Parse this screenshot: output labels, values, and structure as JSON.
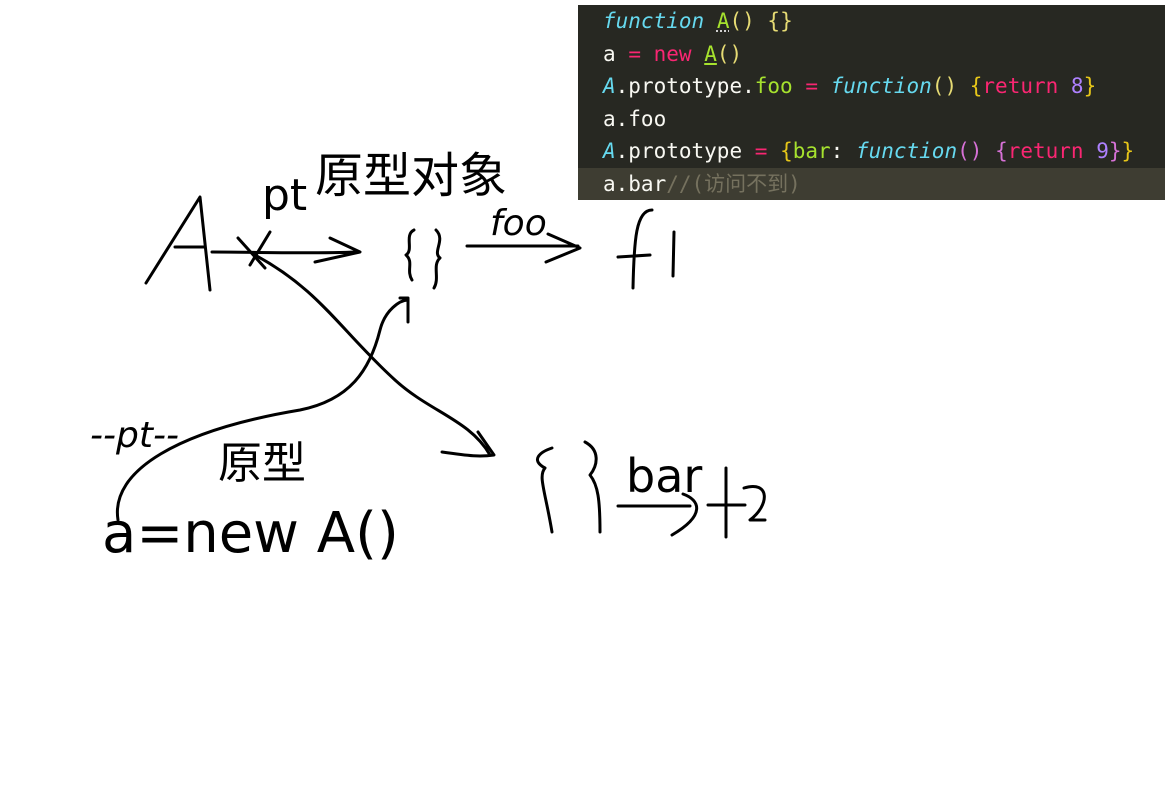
{
  "diagram": {
    "labels": {
      "a_node": "A",
      "pt_top": "pt",
      "proto_obj_label": "原型对象",
      "empty_obj_1": "{}",
      "foo_edge": "foo",
      "f1_node": "f1",
      "pt_dashed": "--pt--",
      "proto_label_2": "原型",
      "instance_expr": "a=new A()",
      "empty_obj_2": "{}",
      "bar_edge": "bar",
      "f2_node": "f2"
    }
  },
  "code": {
    "lines": [
      {
        "tokens": [
          {
            "t": "function",
            "c": "kw"
          },
          {
            "t": " ",
            "c": "id"
          },
          {
            "t": "A",
            "c": "nm dots"
          },
          {
            "t": "()",
            "c": "pn"
          },
          {
            "t": " ",
            "c": "id"
          },
          {
            "t": "{}",
            "c": "pn"
          }
        ]
      },
      {
        "tokens": [
          {
            "t": "a",
            "c": "id"
          },
          {
            "t": " ",
            "c": "id"
          },
          {
            "t": "=",
            "c": "op"
          },
          {
            "t": " ",
            "c": "id"
          },
          {
            "t": "new",
            "c": "op"
          },
          {
            "t": " ",
            "c": "id"
          },
          {
            "t": "A",
            "c": "nm ul"
          },
          {
            "t": "()",
            "c": "pn"
          }
        ]
      },
      {
        "tokens": [
          {
            "t": "A",
            "c": "cls"
          },
          {
            "t": ".prototype.",
            "c": "id"
          },
          {
            "t": "foo",
            "c": "nm"
          },
          {
            "t": " ",
            "c": "id"
          },
          {
            "t": "=",
            "c": "op"
          },
          {
            "t": " ",
            "c": "id"
          },
          {
            "t": "function",
            "c": "kw"
          },
          {
            "t": "()",
            "c": "pn"
          },
          {
            "t": " ",
            "c": "id"
          },
          {
            "t": "{",
            "c": "brace1"
          },
          {
            "t": "return",
            "c": "op"
          },
          {
            "t": " ",
            "c": "id"
          },
          {
            "t": "8",
            "c": "num"
          },
          {
            "t": "}",
            "c": "brace1"
          }
        ]
      },
      {
        "tokens": [
          {
            "t": "a.foo",
            "c": "id"
          }
        ]
      },
      {
        "tokens": [
          {
            "t": "A",
            "c": "cls"
          },
          {
            "t": ".prototype",
            "c": "id"
          },
          {
            "t": " ",
            "c": "id"
          },
          {
            "t": "=",
            "c": "op"
          },
          {
            "t": " ",
            "c": "id"
          },
          {
            "t": "{",
            "c": "brace1"
          },
          {
            "t": "bar",
            "c": "nm"
          },
          {
            "t": ": ",
            "c": "id"
          },
          {
            "t": "function",
            "c": "kw"
          },
          {
            "t": "()",
            "c": "brace2"
          },
          {
            "t": " ",
            "c": "id"
          },
          {
            "t": "{",
            "c": "brace2"
          },
          {
            "t": "return",
            "c": "op"
          },
          {
            "t": " ",
            "c": "id"
          },
          {
            "t": "9",
            "c": "num"
          },
          {
            "t": "}",
            "c": "brace2"
          },
          {
            "t": "}",
            "c": "brace1"
          }
        ]
      },
      {
        "active": true,
        "tokens": [
          {
            "t": "a.bar",
            "c": "id"
          },
          {
            "t": "//(访问不到)",
            "c": "cm"
          }
        ]
      }
    ]
  }
}
